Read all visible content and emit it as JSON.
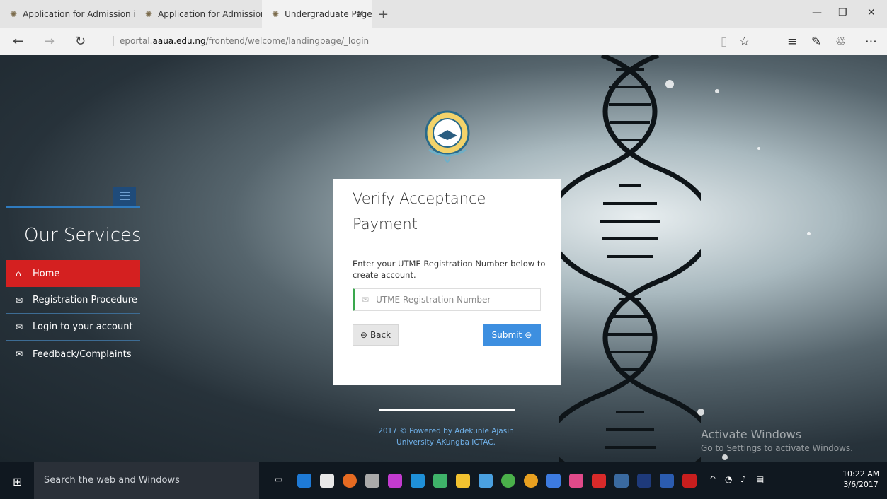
{
  "tabs": [
    {
      "label": "Application for Admission in"
    },
    {
      "label": "Application for Admission in"
    },
    {
      "label": "Undergraduate Page | A"
    }
  ],
  "address": {
    "prefix": "eportal.",
    "domain": "aaua.edu.ng",
    "path": "/frontend/welcome/landingpage/_login"
  },
  "sidebar": {
    "title": "Our Services",
    "items": [
      {
        "label": "Home"
      },
      {
        "label": "Registration Procedure"
      },
      {
        "label": "Login to your account"
      },
      {
        "label": "Feedback/Complaints"
      }
    ]
  },
  "form": {
    "title": "Verify Acceptance Payment",
    "hint": "Enter your UTME Registration Number below to create account.",
    "placeholder": "UTME Registration Number",
    "back_label": "Back",
    "submit_label": "Submit"
  },
  "footer": {
    "line1": "2017 © Powered by Adekunle Ajasin",
    "line2": "University AKungba ICTAC."
  },
  "watermark": {
    "title": "Activate Windows",
    "subtitle": "Go to Settings to activate Windows."
  },
  "taskbar": {
    "search_placeholder": "Search the web and Windows",
    "time": "10:22 AM",
    "date": "3/6/2017"
  },
  "colors": {
    "active_menu": "#d42020",
    "submit": "#3d8fe0",
    "footer_text": "#6fb0e8",
    "input_accent": "#3aa84d"
  }
}
